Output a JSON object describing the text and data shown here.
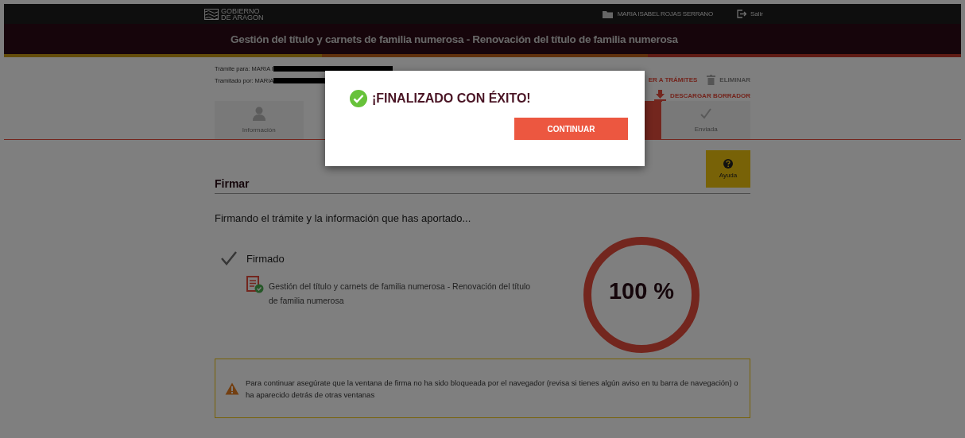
{
  "header": {
    "logo": [
      "GOBIERNO",
      "DE ARAGON"
    ],
    "user": "MARIA ISABEL ROJAS SERRANO",
    "logout": "Salir"
  },
  "title": "Gestión del título y carnets de familia numerosa - Renovación del título de familia numerosa",
  "applicant": [
    {
      "label": "Trámite para: MARIA I"
    },
    {
      "label": "Tramitado por: MARIA"
    }
  ],
  "actions": [
    {
      "kind": "back",
      "label": "ER A TRÁMITES",
      "disabled": false
    },
    {
      "kind": "delete",
      "label": "ELIMINAR",
      "disabled": true
    },
    {
      "kind": "download",
      "label": "DESCARGAR BORRADOR",
      "disabled": false
    }
  ],
  "tabs": [
    {
      "kind": "user",
      "label": "Información",
      "selected": false
    },
    {
      "kind": "sign",
      "selected": true
    },
    {
      "kind": "check",
      "label": "Enviada",
      "selected": false
    }
  ],
  "help": "Ayuda",
  "section": "Firmar",
  "status": "Firmando el trámite y la información que has aportado...",
  "step": {
    "label": "Firmado",
    "done": true
  },
  "document": "Gestión del título y carnets de familia numerosa - Renovación del título de familia numerosa",
  "progress": {
    "level": 1,
    "reading": "100 %"
  },
  "warning": "Para continuar asegúrate que la ventana de firma no ha sido bloqueada por el navegador (revisa si tienes algún aviso en tu barra de navegación) o ha aparecido detrás de otras ventanas",
  "dialog": {
    "title": "¡FINALIZADO CON ÉXITO!",
    "button": "CONTINUAR"
  }
}
